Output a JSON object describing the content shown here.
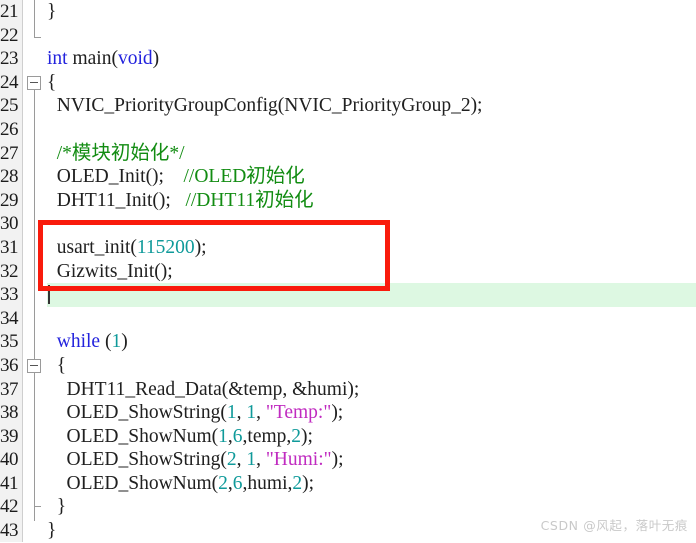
{
  "editor": {
    "first_line": 21,
    "last_line": 43,
    "line_height": 23.6,
    "colors": {
      "background": "#ffffff",
      "gutter_background": "#f2f2f2",
      "keyword": "#2222dd",
      "number": "#0f9a9a",
      "string": "#c02bc0",
      "comment": "#128c12",
      "plain_text": "#202020",
      "current_line_highlight": "#ddf8e2",
      "annotation_box": "#f91b0c"
    }
  },
  "gutter": {
    "line_numbers": [
      "21",
      "22",
      "23",
      "24",
      "25",
      "26",
      "27",
      "28",
      "29",
      "30",
      "31",
      "32",
      "33",
      "34",
      "35",
      "36",
      "37",
      "38",
      "39",
      "40",
      "41",
      "42",
      "43"
    ],
    "fold_markers": [
      {
        "line": "24",
        "type": "collapse-box"
      },
      {
        "line": "36",
        "type": "collapse-box"
      }
    ]
  },
  "code": {
    "lines": [
      {
        "line": "21",
        "tokens": [
          {
            "t": "}",
            "c": "plain"
          }
        ]
      },
      {
        "line": "22",
        "tokens": []
      },
      {
        "line": "23",
        "tokens": [
          {
            "t": "int ",
            "c": "kw"
          },
          {
            "t": "main(",
            "c": "plain"
          },
          {
            "t": "void",
            "c": "kw"
          },
          {
            "t": ")",
            "c": "plain"
          }
        ]
      },
      {
        "line": "24",
        "tokens": [
          {
            "t": "{",
            "c": "plain"
          }
        ]
      },
      {
        "line": "25",
        "tokens": [
          {
            "t": "  NVIC_PriorityGroupConfig(NVIC_PriorityGroup_2);",
            "c": "plain"
          }
        ]
      },
      {
        "line": "26",
        "tokens": []
      },
      {
        "line": "27",
        "tokens": [
          {
            "t": "  /*模块初始化*/",
            "c": "cmt"
          }
        ]
      },
      {
        "line": "28",
        "tokens": [
          {
            "t": "  OLED_Init();    ",
            "c": "plain"
          },
          {
            "t": "//OLED初始化",
            "c": "cmt"
          }
        ]
      },
      {
        "line": "29",
        "tokens": [
          {
            "t": "  DHT11_Init();   ",
            "c": "plain"
          },
          {
            "t": "//DHT11初始化",
            "c": "cmt"
          }
        ]
      },
      {
        "line": "30",
        "tokens": []
      },
      {
        "line": "31",
        "tokens": [
          {
            "t": "  usart_init(",
            "c": "plain"
          },
          {
            "t": "115200",
            "c": "num"
          },
          {
            "t": ");",
            "c": "plain"
          }
        ]
      },
      {
        "line": "32",
        "tokens": [
          {
            "t": "  Gizwits_Init();",
            "c": "plain"
          }
        ]
      },
      {
        "line": "33",
        "tokens": [],
        "current": true
      },
      {
        "line": "34",
        "tokens": []
      },
      {
        "line": "35",
        "tokens": [
          {
            "t": "  ",
            "c": "plain"
          },
          {
            "t": "while",
            "c": "kw"
          },
          {
            "t": " (",
            "c": "plain"
          },
          {
            "t": "1",
            "c": "num"
          },
          {
            "t": ")",
            "c": "plain"
          }
        ]
      },
      {
        "line": "36",
        "tokens": [
          {
            "t": "  {",
            "c": "plain"
          }
        ]
      },
      {
        "line": "37",
        "tokens": [
          {
            "t": "    DHT11_Read_Data(&temp, &humi);",
            "c": "plain"
          }
        ]
      },
      {
        "line": "38",
        "tokens": [
          {
            "t": "    OLED_ShowString(",
            "c": "plain"
          },
          {
            "t": "1",
            "c": "num"
          },
          {
            "t": ", ",
            "c": "plain"
          },
          {
            "t": "1",
            "c": "num"
          },
          {
            "t": ", ",
            "c": "plain"
          },
          {
            "t": "\"Temp:\"",
            "c": "str"
          },
          {
            "t": ");",
            "c": "plain"
          }
        ]
      },
      {
        "line": "39",
        "tokens": [
          {
            "t": "    OLED_ShowNum(",
            "c": "plain"
          },
          {
            "t": "1",
            "c": "num"
          },
          {
            "t": ",",
            "c": "plain"
          },
          {
            "t": "6",
            "c": "num"
          },
          {
            "t": ",temp,",
            "c": "plain"
          },
          {
            "t": "2",
            "c": "num"
          },
          {
            "t": ");",
            "c": "plain"
          }
        ]
      },
      {
        "line": "40",
        "tokens": [
          {
            "t": "    OLED_ShowString(",
            "c": "plain"
          },
          {
            "t": "2",
            "c": "num"
          },
          {
            "t": ", ",
            "c": "plain"
          },
          {
            "t": "1",
            "c": "num"
          },
          {
            "t": ", ",
            "c": "plain"
          },
          {
            "t": "\"Humi:\"",
            "c": "str"
          },
          {
            "t": ");",
            "c": "plain"
          }
        ]
      },
      {
        "line": "41",
        "tokens": [
          {
            "t": "    OLED_ShowNum(",
            "c": "plain"
          },
          {
            "t": "2",
            "c": "num"
          },
          {
            "t": ",",
            "c": "plain"
          },
          {
            "t": "6",
            "c": "num"
          },
          {
            "t": ",humi,",
            "c": "plain"
          },
          {
            "t": "2",
            "c": "num"
          },
          {
            "t": ");",
            "c": "plain"
          }
        ]
      },
      {
        "line": "42",
        "tokens": [
          {
            "t": "  }",
            "c": "plain"
          }
        ]
      },
      {
        "line": "43",
        "tokens": [
          {
            "t": "}",
            "c": "plain"
          }
        ]
      }
    ]
  },
  "annotation": {
    "type": "red-rectangle",
    "covers_lines": [
      "31",
      "32"
    ],
    "label": "usart-init-highlight"
  },
  "caret": {
    "line": "33",
    "visible": true
  },
  "watermark": {
    "text": "CSDN @风起，落叶无痕"
  }
}
